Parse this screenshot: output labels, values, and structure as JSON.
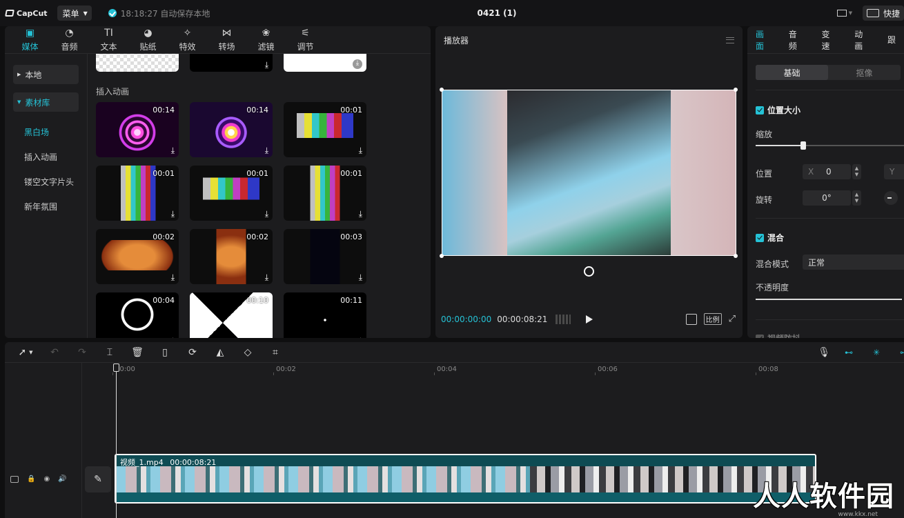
{
  "topbar": {
    "logo": "CapCut",
    "menu_label": "菜单",
    "autosave": "18:18:27 自动保存本地",
    "project_title": "0421 (1)",
    "shortcut_label": "快捷"
  },
  "media": {
    "tabs": [
      {
        "label": "媒体",
        "icon": "▣"
      },
      {
        "label": "音频",
        "icon": "◔"
      },
      {
        "label": "文本",
        "icon": "TI"
      },
      {
        "label": "贴纸",
        "icon": "◕"
      },
      {
        "label": "特效",
        "icon": "✧"
      },
      {
        "label": "转场",
        "icon": "⋈"
      },
      {
        "label": "滤镜",
        "icon": "❀"
      },
      {
        "label": "调节",
        "icon": "⚟"
      }
    ],
    "side_groups": [
      "本地",
      "素材库"
    ],
    "side_items": [
      "黑白场",
      "插入动画",
      "镂空文字片头",
      "新年氛围"
    ],
    "section_label": "插入动画",
    "thumbs": [
      {
        "dur": "00:14",
        "kind": "heart-pink"
      },
      {
        "dur": "00:14",
        "kind": "heart-purple"
      },
      {
        "dur": "00:01",
        "kind": "bars-wide"
      },
      {
        "dur": "00:01",
        "kind": "bars-tall"
      },
      {
        "dur": "00:01",
        "kind": "bars-wide2"
      },
      {
        "dur": "00:01",
        "kind": "bars-tall2"
      },
      {
        "dur": "00:02",
        "kind": "the-end-wide"
      },
      {
        "dur": "00:02",
        "kind": "the-end-tall"
      },
      {
        "dur": "00:03",
        "kind": "loading"
      },
      {
        "dur": "00:04",
        "kind": "circle"
      },
      {
        "dur": "00:10",
        "kind": "diamond"
      },
      {
        "dur": "00:11",
        "kind": "triangle"
      }
    ]
  },
  "player": {
    "title": "播放器",
    "current_time": "00:00:00:00",
    "total_time": "00:00:08:21",
    "ratio_label": "比例"
  },
  "props": {
    "tabs": [
      "画面",
      "音频",
      "变速",
      "动画",
      "跟"
    ],
    "seg": [
      "基础",
      "抠像"
    ],
    "section_position": "位置大小",
    "scale_label": "缩放",
    "scale_value": 0.3,
    "position_label": "位置",
    "x_axis": "X",
    "x_value": "0",
    "y_axis": "Y",
    "rotate_label": "旋转",
    "rotate_value": "0°",
    "section_blend": "混合",
    "blend_mode_label": "混合模式",
    "blend_mode_value": "正常",
    "opacity_label": "不透明度",
    "opacity_value": 1.0,
    "section_stabilize": "视频防抖"
  },
  "timeline": {
    "ruler": [
      "00:00",
      "00:02",
      "00:04",
      "00:06",
      "00:08"
    ],
    "clip_name": "视频_1.mp4",
    "clip_duration": "00:00:08:21"
  },
  "watermark": {
    "text": "人人软件园",
    "sub": "www.kkx.net"
  },
  "colors": {
    "accent": "#25c2d6",
    "clip": "#0e4b53"
  }
}
